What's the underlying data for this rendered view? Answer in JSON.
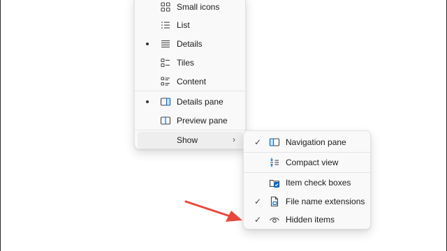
{
  "view_menu": {
    "items": [
      {
        "label": "Small icons",
        "icon": "small-icons-icon",
        "selected": false
      },
      {
        "label": "List",
        "icon": "list-icon",
        "selected": false
      },
      {
        "label": "Details",
        "icon": "details-icon",
        "selected": true
      },
      {
        "label": "Tiles",
        "icon": "tiles-icon",
        "selected": false
      },
      {
        "label": "Content",
        "icon": "content-icon",
        "selected": false
      }
    ],
    "panes": [
      {
        "label": "Details pane",
        "icon": "details-pane-icon",
        "selected": true
      },
      {
        "label": "Preview pane",
        "icon": "preview-pane-icon",
        "selected": false
      }
    ],
    "show": {
      "label": "Show",
      "chevron": "›"
    }
  },
  "show_menu": {
    "items": [
      {
        "label": "Navigation pane",
        "icon": "navigation-pane-icon",
        "checked": true
      },
      {
        "label": "Compact view",
        "icon": "compact-view-icon",
        "checked": false
      },
      {
        "label": "Item check boxes",
        "icon": "item-check-boxes-icon",
        "checked": false
      },
      {
        "label": "File name extensions",
        "icon": "file-name-extensions-icon",
        "checked": true
      },
      {
        "label": "Hidden items",
        "icon": "hidden-items-icon",
        "checked": true
      }
    ],
    "check_glyph": "✓"
  },
  "colors": {
    "accent": "#0067c0",
    "arrow": "#e8483b",
    "menu_bg": "#f9f9f9",
    "hover_bg": "#eeeeee"
  }
}
